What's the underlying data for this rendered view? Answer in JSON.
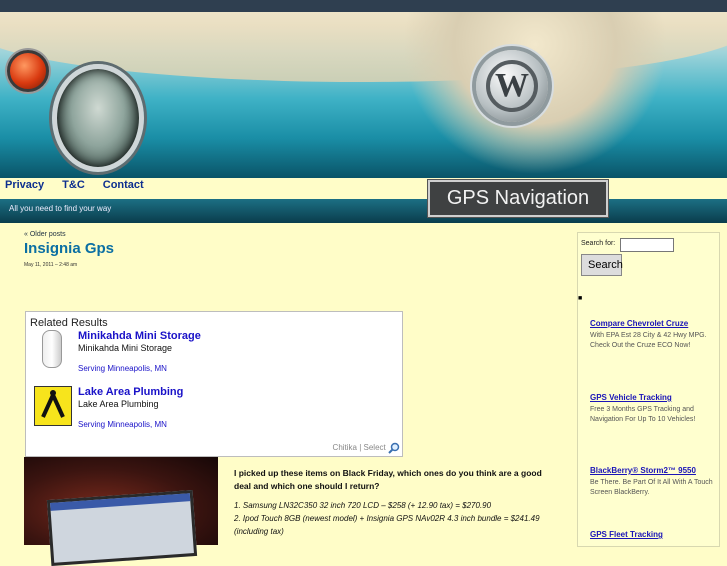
{
  "nav": {
    "privacy": "Privacy",
    "tc": "T&C",
    "contact": "Contact"
  },
  "site_title": "GPS Navigation",
  "tagline": "All you need to find your way",
  "older_posts": "« Older posts",
  "post": {
    "title": "Insignia Gps",
    "date": "May 11, 2011 – 2:48 am",
    "question": "I picked up these items on Black Friday, which ones do you think are a good deal and which one should I return?",
    "items": [
      "1. Samsung LN32C350 32 inch 720 LCD – $258 (+ 12.90 tax) = $270.90",
      "2. Ipod Touch 8GB (newest model) + Insignia GPS NAv02R 4.3 inch bundle = $241.49 (including tax)"
    ]
  },
  "related": {
    "heading": "Related Results",
    "results": [
      {
        "title": "Minikahda Mini Storage",
        "subtitle": "Minikahda Mini Storage",
        "location": "Serving Minneapolis, MN"
      },
      {
        "title": "Lake Area Plumbing",
        "subtitle": "Lake Area Plumbing",
        "location": "Serving Minneapolis, MN"
      }
    ],
    "footer": "Chitika | Select"
  },
  "sidebar": {
    "search_label": "Search for:",
    "search_value": "",
    "search_button": "Search",
    "ads": [
      {
        "title": "Compare Chevrolet Cruze",
        "desc": "With EPA Est 28 City & 42 Hwy MPG. Check Out the Cruze ECO Now!"
      },
      {
        "title": "GPS Vehicle Tracking",
        "desc": "Free 3 Months GPS Tracking and Navigation For Up To 10 Vehicles!"
      },
      {
        "title": "BlackBerry® Storm2™ 9550",
        "desc": "Be There. Be Part Of It All With A Touch Screen BlackBerry."
      },
      {
        "title": "GPS Fleet Tracking",
        "desc": ""
      }
    ]
  }
}
